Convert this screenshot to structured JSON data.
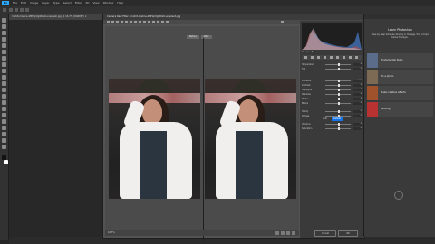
{
  "app": {
    "logo": "Ps",
    "menu": [
      "File",
      "Edit",
      "Image",
      "Layer",
      "Type",
      "Select",
      "Filter",
      "3D",
      "View",
      "Window",
      "Help"
    ],
    "doc_tab": "mohit-mishra-4MHqrXg9DG0-unsplash.jpg @ 16.7% (RGB/8*) ×"
  },
  "camera_raw": {
    "title": "Camera Raw Filter - mohit-mishra-4MHqrXg9DG0-unsplash.jpg",
    "preview_labels": [
      "Before",
      "After"
    ],
    "zoom": "16.7%",
    "histogram_info": "R:--- G:--- B:---",
    "panel_sliders": [
      {
        "label": "Temperature",
        "value": "0"
      },
      {
        "label": "Tint",
        "value": "0"
      },
      {
        "label": "Exposure",
        "value": "0.00"
      },
      {
        "label": "Contrast",
        "value": "0"
      },
      {
        "label": "Highlights",
        "value": "0"
      },
      {
        "label": "Shadows",
        "value": "0"
      },
      {
        "label": "Whites",
        "value": "0"
      },
      {
        "label": "Blacks",
        "value": "0"
      },
      {
        "label": "Clarity",
        "value": "0"
      },
      {
        "label": "Dehaze",
        "value": "0"
      },
      {
        "label": "Vibrance",
        "value": "0"
      },
      {
        "label": "Saturation",
        "value": "0"
      }
    ],
    "tone_buttons": [
      "Auto",
      "Default"
    ],
    "actions": {
      "cancel": "Cancel",
      "ok": "OK"
    }
  },
  "learn": {
    "title": "Learn Photoshop",
    "subtitle": "Step-by-step tutorials directly in the app. Pick a topic below to begin.",
    "items": [
      {
        "label": "Fundamental Skills",
        "thumb_color": "#5b6b8a"
      },
      {
        "label": "Fix a photo",
        "thumb_color": "#7d6a55"
      },
      {
        "label": "Make creative effects",
        "thumb_color": "#a0522d"
      },
      {
        "label": "Painting",
        "thumb_color": "#b83232"
      }
    ],
    "footer": "Learn Photoshop\nStep-by-step tutorials..."
  }
}
